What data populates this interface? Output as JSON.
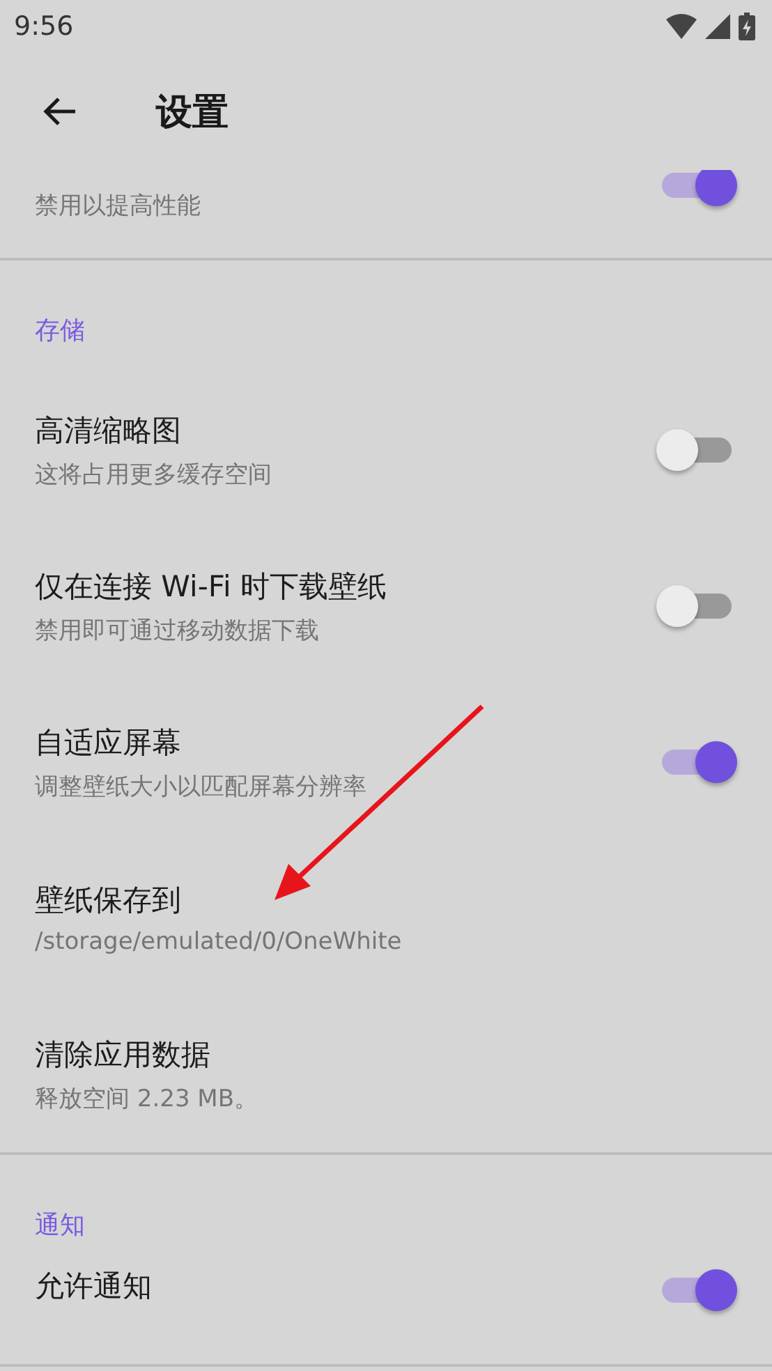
{
  "status_bar": {
    "time": "9:56"
  },
  "header": {
    "title": "设置"
  },
  "partial_item": {
    "subtitle": "禁用以提高性能",
    "kind": "toggle",
    "on": true
  },
  "sections": [
    {
      "title": "存储",
      "items": [
        {
          "kind": "toggle",
          "title": "高清缩略图",
          "subtitle": "这将占用更多缓存空间",
          "on": false
        },
        {
          "kind": "toggle",
          "title": "仅在连接 Wi-Fi 时下载壁纸",
          "subtitle": "禁用即可通过移动数据下载",
          "on": false
        },
        {
          "kind": "toggle",
          "title": "自适应屏幕",
          "subtitle": "调整壁纸大小以匹配屏幕分辨率",
          "on": true
        },
        {
          "kind": "info",
          "title": "壁纸保存到",
          "subtitle": "/storage/emulated/0/OneWhite"
        },
        {
          "kind": "info",
          "title": "清除应用数据",
          "subtitle": "释放空间 2.23 MB。"
        }
      ]
    },
    {
      "title": "通知",
      "items": [
        {
          "kind": "toggle",
          "title": "允许通知",
          "on": true
        }
      ]
    }
  ]
}
